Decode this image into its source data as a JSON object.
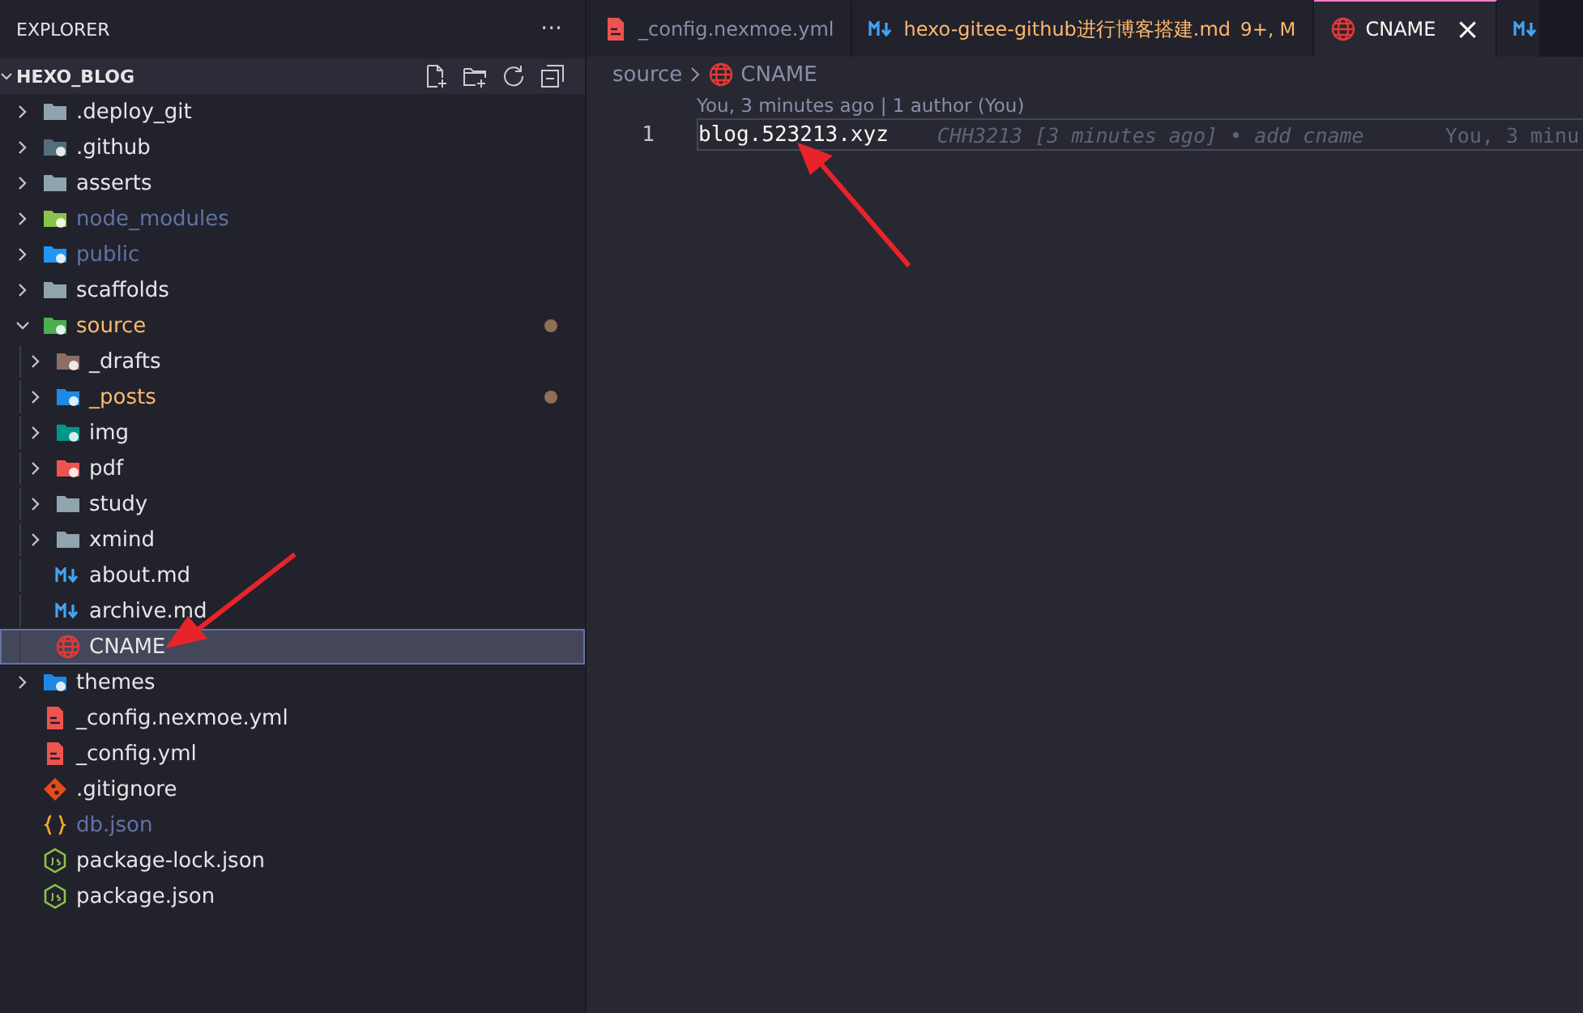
{
  "sidebar": {
    "title": "EXPLORER",
    "more": "···",
    "root": {
      "label": "HEXO_BLOG",
      "expanded": true
    },
    "items": [
      {
        "label": ".deploy_git",
        "kind": "folder",
        "expanded": false,
        "modified": false,
        "ignored": false,
        "selected": false
      },
      {
        "label": ".github",
        "kind": "github",
        "expanded": false,
        "modified": false,
        "ignored": false,
        "selected": false
      },
      {
        "label": "asserts",
        "kind": "folder",
        "expanded": false,
        "modified": false,
        "ignored": false,
        "selected": false
      },
      {
        "label": "node_modules",
        "kind": "npm",
        "expanded": false,
        "modified": false,
        "ignored": true,
        "selected": false
      },
      {
        "label": "public",
        "kind": "web",
        "expanded": false,
        "modified": false,
        "ignored": true,
        "selected": false
      },
      {
        "label": "scaffolds",
        "kind": "folder",
        "expanded": false,
        "modified": false,
        "ignored": false,
        "selected": false
      },
      {
        "label": "source",
        "kind": "code",
        "expanded": true,
        "modified": true,
        "ignored": false,
        "selected": false,
        "children": [
          {
            "label": "_drafts",
            "kind": "drafts",
            "expanded": false,
            "modified": false,
            "ignored": false,
            "selected": false
          },
          {
            "label": "_posts",
            "kind": "docs",
            "expanded": false,
            "modified": true,
            "ignored": false,
            "selected": false
          },
          {
            "label": "img",
            "kind": "images",
            "expanded": false,
            "modified": false,
            "ignored": false,
            "selected": false
          },
          {
            "label": "pdf",
            "kind": "pdf",
            "expanded": false,
            "modified": false,
            "ignored": false,
            "selected": false
          },
          {
            "label": "study",
            "kind": "folder",
            "expanded": false,
            "modified": false,
            "ignored": false,
            "selected": false
          },
          {
            "label": "xmind",
            "kind": "folder",
            "expanded": false,
            "modified": false,
            "ignored": false,
            "selected": false
          },
          {
            "label": "about.md",
            "kind": "markdown",
            "modified": false,
            "ignored": false,
            "selected": false
          },
          {
            "label": "archive.md",
            "kind": "markdown",
            "modified": false,
            "ignored": false,
            "selected": false
          },
          {
            "label": "CNAME",
            "kind": "globe",
            "modified": false,
            "ignored": false,
            "selected": true
          }
        ]
      },
      {
        "label": "themes",
        "kind": "themes",
        "expanded": false,
        "modified": false,
        "ignored": false,
        "selected": false
      },
      {
        "label": "_config.nexmoe.yml",
        "kind": "yaml",
        "modified": false,
        "ignored": false,
        "selected": false
      },
      {
        "label": "_config.yml",
        "kind": "yaml",
        "modified": false,
        "ignored": false,
        "selected": false
      },
      {
        "label": ".gitignore",
        "kind": "git",
        "modified": false,
        "ignored": false,
        "selected": false
      },
      {
        "label": "db.json",
        "kind": "json",
        "modified": false,
        "ignored": true,
        "selected": false
      },
      {
        "label": "package-lock.json",
        "kind": "node",
        "modified": false,
        "ignored": false,
        "selected": false
      },
      {
        "label": "package.json",
        "kind": "node",
        "modified": false,
        "ignored": false,
        "selected": false
      }
    ]
  },
  "tabs": [
    {
      "label": "_config.nexmoe.yml",
      "kind": "yaml",
      "modified": false,
      "selected": false
    },
    {
      "label": "hexo-gitee-github进行博客搭建.md",
      "kind": "markdown",
      "modified": true,
      "badge": "9+, M",
      "selected": false
    },
    {
      "label": "CNAME",
      "kind": "globe",
      "modified": false,
      "selected": true,
      "close": "×"
    },
    {
      "kind": "markdown",
      "selected": false
    }
  ],
  "breadcrumb": [
    {
      "label": "source",
      "kind": "folder"
    },
    {
      "label": "CNAME",
      "kind": "globe"
    }
  ],
  "codelens": "You, 3 minutes ago | 1 author (You)",
  "lines": [
    {
      "number": "1",
      "text": "blog.523213.xyz",
      "blame": "CHH3213 [3 minutes ago] • add cname",
      "blame_2": "You, 3 minu"
    }
  ]
}
